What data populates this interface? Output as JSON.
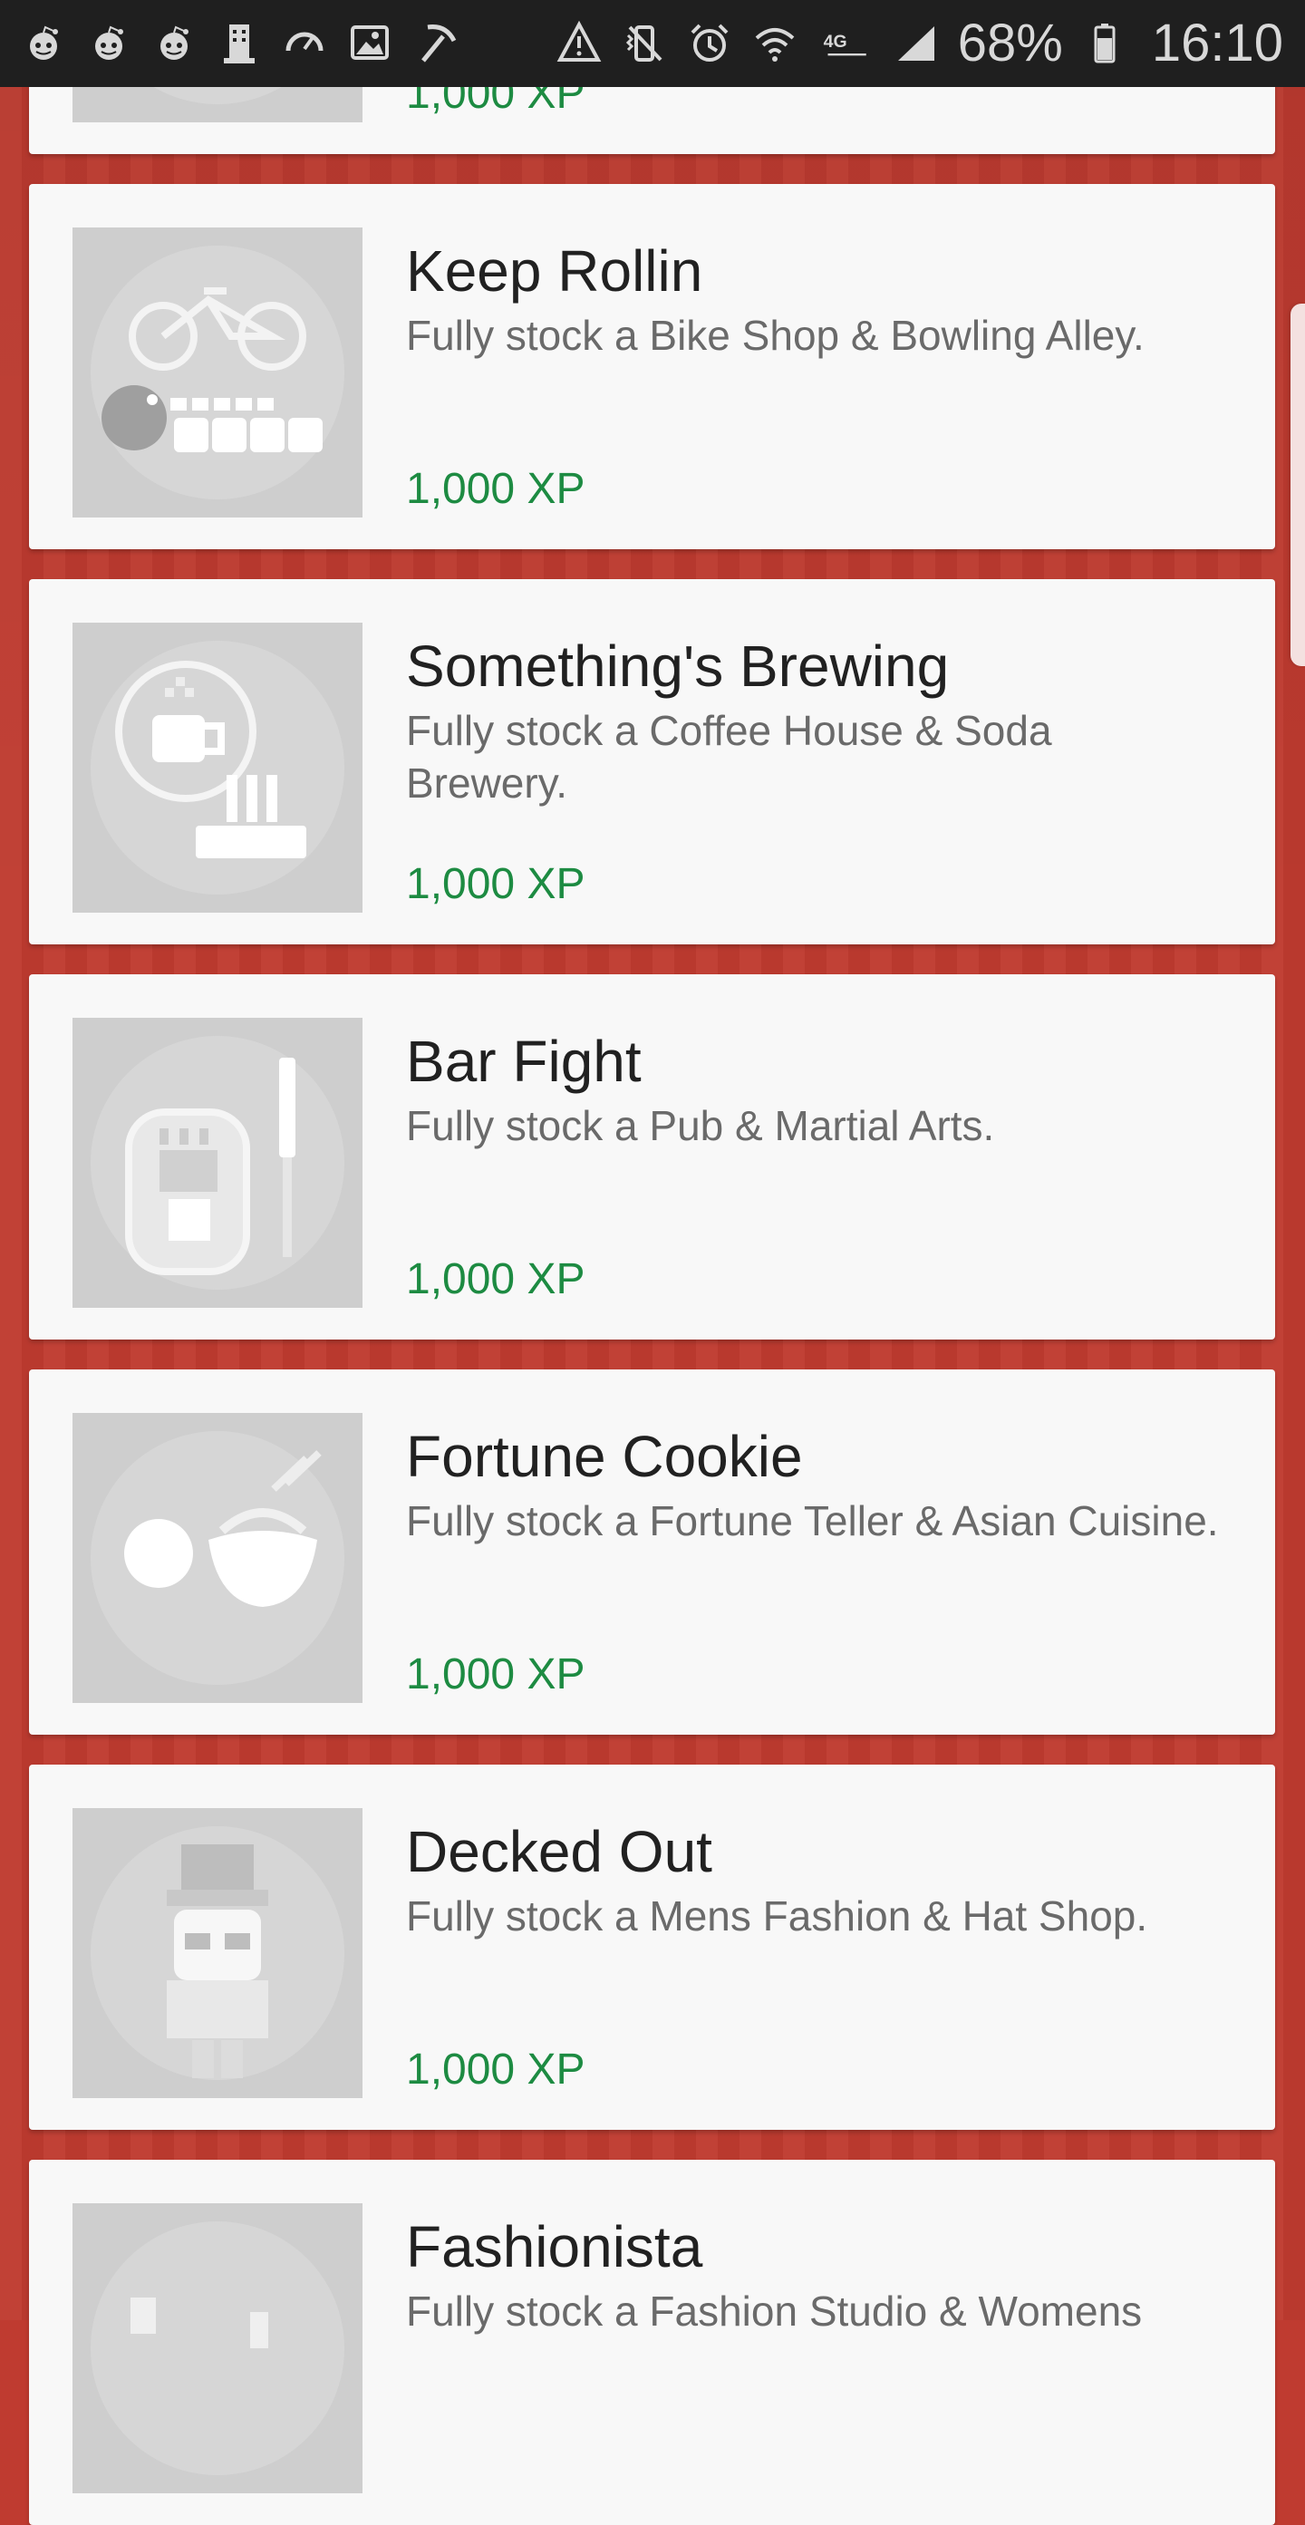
{
  "status_bar": {
    "left_icons": [
      "reddit-icon",
      "reddit-icon",
      "reddit-icon",
      "building-icon",
      "speedometer-icon",
      "image-icon",
      "pickaxe-icon"
    ],
    "right_icons": [
      "network-alert-icon",
      "vibrate-mute-icon",
      "alarm-icon",
      "wifi-icon",
      "lte-icon",
      "signal-icon",
      "battery-icon"
    ],
    "network_label": "4G",
    "battery_percent": "68%",
    "time": "16:10"
  },
  "achievements": [
    {
      "title": "",
      "description": "",
      "reward": "1,000 XP",
      "icon": "partial-icon"
    },
    {
      "title": "Keep Rollin",
      "description": "Fully stock a Bike Shop & Bowling Alley.",
      "reward": "1,000 XP",
      "icon": "bike-bowling-icon"
    },
    {
      "title": "Something's Brewing",
      "description": "Fully stock a Coffee House & Soda Brewery.",
      "reward": "1,000 XP",
      "icon": "coffee-brewery-icon"
    },
    {
      "title": "Bar Fight",
      "description": "Fully stock a Pub & Martial Arts.",
      "reward": "1,000 XP",
      "icon": "pub-martial-icon"
    },
    {
      "title": "Fortune Cookie",
      "description": "Fully stock a Fortune Teller & Asian Cuisine.",
      "reward": "1,000 XP",
      "icon": "fortune-cookie-icon"
    },
    {
      "title": "Decked Out",
      "description": "Fully stock a Mens Fashion & Hat Shop.",
      "reward": "1,000 XP",
      "icon": "decked-out-icon"
    },
    {
      "title": "Fashionista",
      "description": "Fully stock a Fashion Studio & Womens",
      "reward": "",
      "icon": "fashionista-icon"
    }
  ],
  "colors": {
    "background": "#bf3b30",
    "card": "#f8f8f8",
    "title": "#212121",
    "description": "#6a6a6a",
    "reward": "#1d8b42",
    "status_bar": "#1f1f1f"
  }
}
